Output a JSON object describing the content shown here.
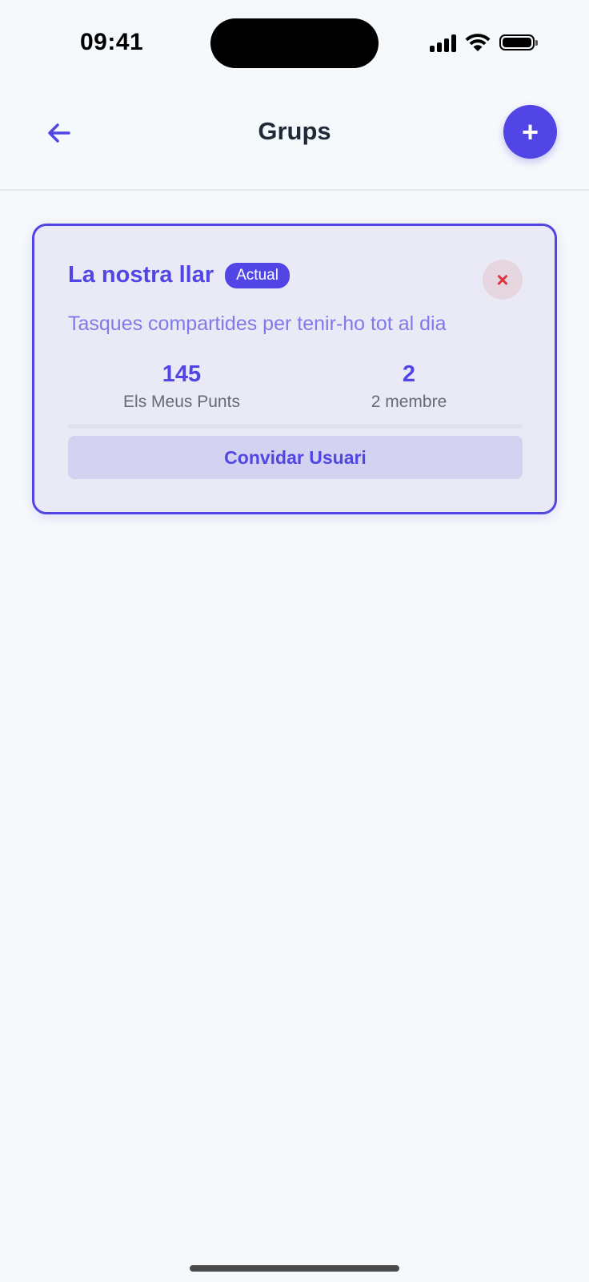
{
  "status_bar": {
    "time": "09:41"
  },
  "header": {
    "title": "Grups",
    "back_icon": "arrow-left-icon",
    "add_label": "+"
  },
  "group": {
    "name": "La nostra llar",
    "badge": "Actual",
    "remove_label": "×",
    "description": "Tasques compartides per tenir-ho tot al dia",
    "stats": [
      {
        "value": "145",
        "label": "Els Meus Punts"
      },
      {
        "value": "2",
        "label": "2 membre"
      }
    ],
    "invite_label": "Convidar Usuari"
  },
  "colors": {
    "accent": "#5146e5",
    "danger": "#e0323a",
    "background": "#f6f9fb"
  }
}
